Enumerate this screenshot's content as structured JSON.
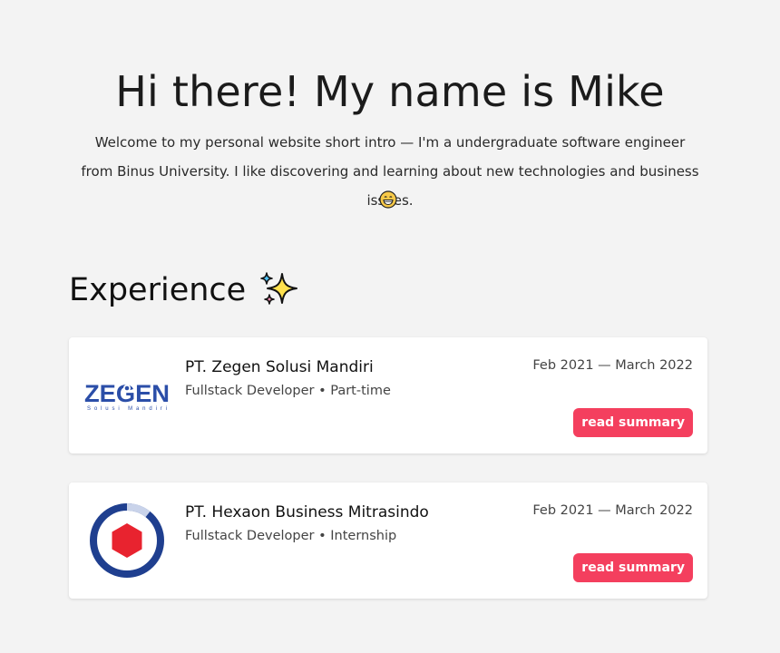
{
  "hero": {
    "title": "Hi there! My name is Mike",
    "intro": "Welcome to my personal website short intro — I'm a undergraduate software engineer from Binus University. I like discovering and learning about new technologies and business issues.",
    "emoji_icon": "grinning-face-icon"
  },
  "experience": {
    "heading": "Experience",
    "heading_icon": "sparkles-icon",
    "items": [
      {
        "company": "PT. Zegen Solusi Mandiri",
        "role": "Fullstack Developer • Part-time",
        "period": "Feb 2021 — March 2022",
        "button_label": "read summary",
        "logo_text": "ZEGEN",
        "logo_subtext": "Solusi Mandiri"
      },
      {
        "company": "PT. Hexaon Business Mitrasindo",
        "role": "Fullstack Developer • Internship",
        "period": "Feb 2021 — March 2022",
        "button_label": "read summary"
      }
    ]
  },
  "colors": {
    "background": "#f3f3f3",
    "card": "#ffffff",
    "accent": "#f43f5e",
    "zegen_blue": "#2b4ea8",
    "hexaon_blue": "#1f3f8f",
    "hexaon_red": "#e8232f"
  }
}
